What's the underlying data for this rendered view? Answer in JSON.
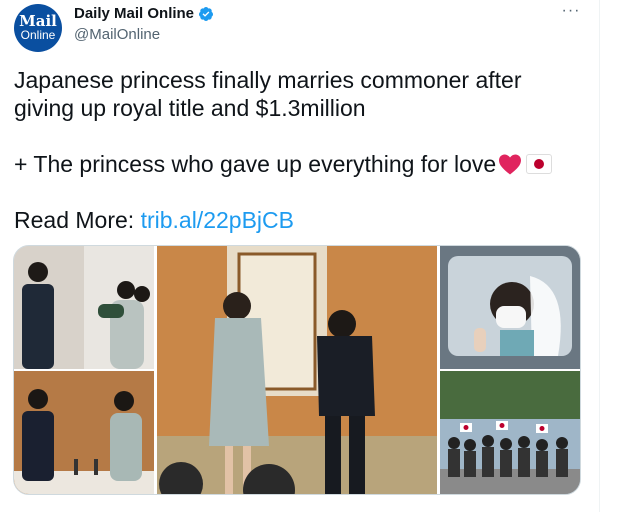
{
  "account": {
    "avatar_line1": "Mail",
    "avatar_line2": "Online",
    "display_name": "Daily Mail Online",
    "handle": "@MailOnline",
    "more_label": "···"
  },
  "tweet": {
    "line1": "Japanese princess finally marries commoner after",
    "line2": "giving up royal title and $1.3million",
    "line3": "+ The princess who gave up everything for love",
    "read_more_label": "Read More:",
    "link_text": "trib.al/22pBjCB"
  },
  "colors": {
    "link": "#1d9bf0",
    "verified": "#1d9bf0",
    "avatar_bg": "#0a4fa0",
    "heart": "#e0245e"
  },
  "icons": [
    "verified-badge-icon",
    "more-options-icon",
    "red-heart-emoji",
    "japan-flag-emoji"
  ]
}
